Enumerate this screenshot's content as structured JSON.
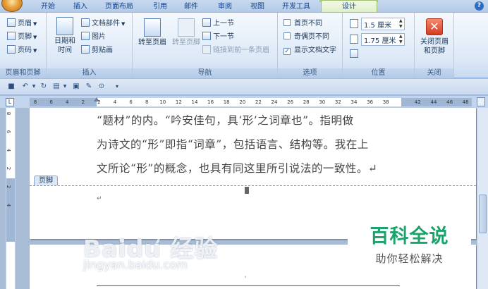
{
  "tabs": [
    "开始",
    "插入",
    "页面布局",
    "引用",
    "邮件",
    "审阅",
    "视图",
    "开发工具",
    "设计"
  ],
  "active_tab": "设计",
  "colors": {
    "accent": "#15428b",
    "context_band": "#a6cf6c",
    "badge_green": "#1aa36a"
  },
  "groups": {
    "header_footer": {
      "label": "页眉和页脚",
      "items": [
        "页眉",
        "页脚",
        "页码"
      ]
    },
    "insert": {
      "label": "插入",
      "date_time": "日期和\n时间",
      "date_time_l1": "日期和",
      "date_time_l2": "时间",
      "quick_parts": "文档部件",
      "picture": "图片",
      "clip_art": "剪贴画"
    },
    "navigation": {
      "label": "导航",
      "goto_header": "转至页眉",
      "goto_footer": "转至页脚",
      "prev": "上一节",
      "next": "下一节",
      "link_prev": "链接到前一条页眉"
    },
    "options": {
      "label": "选项",
      "diff_first": "首页不同",
      "diff_odd_even": "奇偶页不同",
      "show_doc_text": "显示文档文字"
    },
    "position": {
      "label": "位置",
      "header_from_top": "1.5 厘米",
      "footer_from_bottom": "1.75 厘米"
    },
    "close": {
      "label": "关闭",
      "close_l1": "关闭页眉",
      "close_l2": "和页脚"
    }
  },
  "ruler_ticks": [
    "8",
    "6",
    "4",
    "2",
    "2",
    "4",
    "6",
    "8",
    "10",
    "12",
    "14",
    "16",
    "18",
    "20",
    "22",
    "24",
    "26",
    "28",
    "30",
    "32",
    "34",
    "36",
    "38",
    "",
    "42",
    "44",
    "46",
    "48"
  ],
  "vruler_ticks": [
    "8",
    "6",
    "4",
    "2",
    "2",
    "4"
  ],
  "document": {
    "lines": [
      "“题材”的内。“吟安佳句，具‘形’之词章也”。指明做",
      "为诗文的“形”即指“词章”，包括语言、结构等。我在上",
      "文所论“形”的概念，也具有同这里所引说法的一致性。↵"
    ],
    "footer_tag": "页脚"
  },
  "watermark": {
    "baidu": "Baidu 经验",
    "url": "jingyan.baidu.com",
    "badge_title": "百科全说",
    "badge_sub": "助你轻松解决"
  }
}
